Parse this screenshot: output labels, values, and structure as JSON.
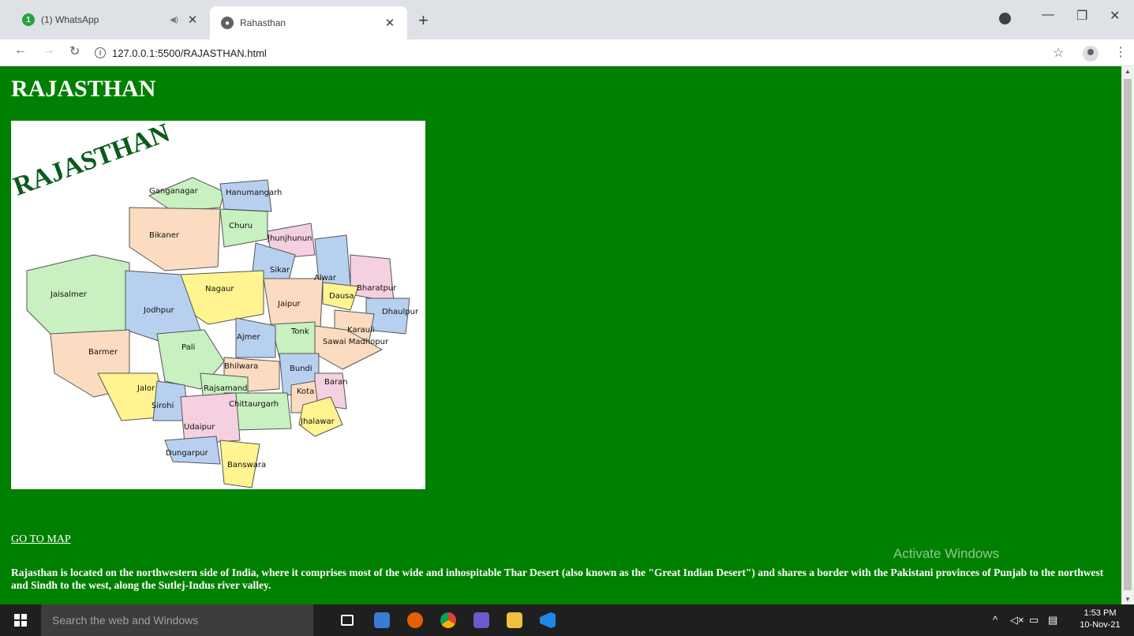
{
  "browser": {
    "tabs": [
      {
        "title": "(1) WhatsApp",
        "badge": "1"
      },
      {
        "title": "Rahasthan"
      }
    ],
    "new_tab": "+",
    "url": "127.0.0.1:5500/RAJASTHAN.html"
  },
  "page": {
    "heading": "RAJASTHAN",
    "map": {
      "banner": "RAJASTHAN",
      "districts": [
        "Ganganagar",
        "Hanumangarh",
        "Bikaner",
        "Churu",
        "Jhunjhunun",
        "Sikar",
        "Alwar",
        "Bharatpur",
        "Jaisalmer",
        "Nagaur",
        "Dausa",
        "Jaipur",
        "Dhaulpur",
        "Jodhpur",
        "Karauli",
        "Tonk",
        "Ajmer",
        "Sawai Madhopur",
        "Barmer",
        "Bhilwara",
        "Bundi",
        "Pali",
        "Rajsamand",
        "Baran",
        "Kota",
        "Jalor",
        "Chittaurgarh",
        "Sirohi",
        "Jhalawar",
        "Udaipur",
        "Dungarpur",
        "Banswara"
      ]
    },
    "link_text": "GO TO MAP",
    "description": "Rajasthan is located on the northwestern side of India, where it comprises most of the wide and inhospitable Thar Desert (also known as the \"Great Indian Desert\") and shares a border with the Pakistani provinces of Punjab to the northwest and Sindh to the west, along the Sutlej-Indus river valley.",
    "watermark": "Activate Windows"
  },
  "taskbar": {
    "search_placeholder": "Search the web and Windows",
    "time": "1:53 PM",
    "date": "10-Nov-21"
  },
  "colors": {
    "page_bg": "#008000",
    "map_green": "#c8f0c0",
    "map_blue": "#b8d0f0",
    "map_peach": "#fbdcc0",
    "map_yellow": "#fff490",
    "map_pink": "#f5d0e0"
  }
}
